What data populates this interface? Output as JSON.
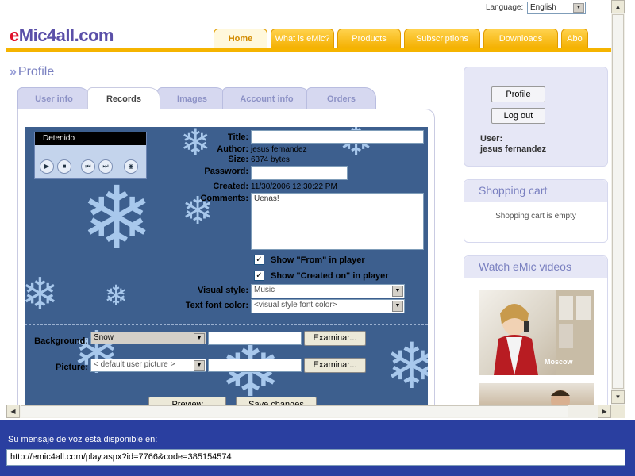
{
  "header": {
    "language_label": "Language:",
    "language_value": "English",
    "logo_e": "e",
    "logo_rest": "Mic4all.com",
    "tabs": [
      "Home",
      "What is eMic?",
      "Products",
      "Subscriptions",
      "Downloads",
      "Abo"
    ]
  },
  "page": {
    "title": "Profile",
    "tabs": [
      "User info",
      "Records",
      "Images",
      "Account info",
      "Orders"
    ],
    "active_tab": "Records"
  },
  "player": {
    "status": "Detenido",
    "buttons": [
      "play-icon",
      "stop-icon",
      "prev-icon",
      "next-icon",
      "volume-icon"
    ]
  },
  "record": {
    "title_label": "Title:",
    "title_value": "",
    "author_label": "Author:",
    "author_value": "jesus fernandez",
    "size_label": "Size:",
    "size_value": "6374 bytes",
    "password_label": "Password:",
    "password_value": "",
    "created_label": "Created:",
    "created_value": "11/30/2006 12:30:22 PM",
    "comments_label": "Comments:",
    "comments_value": "Uenas!",
    "show_from_label": "Show \"From\" in player",
    "show_from_checked": true,
    "show_created_label": "Show \"Created on\" in player",
    "show_created_checked": true,
    "visual_style_label": "Visual style:",
    "visual_style_value": "Music",
    "font_color_label": "Text font color:",
    "font_color_value": "<visual style font color>",
    "background_label": "Background:",
    "background_value": "Snow",
    "background_browse": "Examinar...",
    "picture_label": "Picture:",
    "picture_value": "< default user picture >",
    "picture_browse": "Examinar...",
    "preview_button": "Preview",
    "save_button": "Save changes"
  },
  "sidebar": {
    "profile_button": "Profile",
    "logout_button": "Log out",
    "user_label": "User:",
    "user_name": "jesus fernandez",
    "cart_title": "Shopping cart",
    "cart_empty": "Shopping cart is empty",
    "videos_title": "Watch eMic videos",
    "video_caption": "Moscow"
  },
  "footer": {
    "voice_label": "Su mensaje de voz está disponible en:",
    "url_value": "http://emic4all.com/play.aspx?id=7766&code=385154574"
  },
  "colors": {
    "brand_purple": "#5a4fa8",
    "brand_red": "#e0102a",
    "tab_orange": "#f4b000",
    "record_background": "#3d5f8e",
    "window_blue": "#2a3fa0"
  }
}
